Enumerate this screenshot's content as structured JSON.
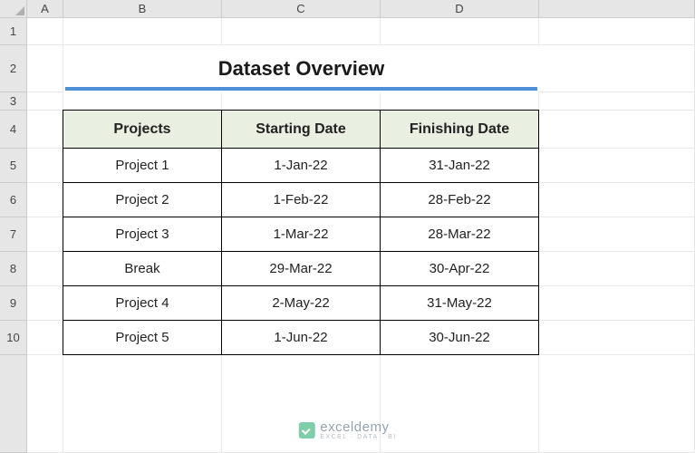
{
  "columns": [
    "A",
    "B",
    "C",
    "D"
  ],
  "rows": [
    "1",
    "2",
    "3",
    "4",
    "5",
    "6",
    "7",
    "8",
    "9",
    "10"
  ],
  "title": "Dataset Overview",
  "chart_data": {
    "type": "table",
    "title": "Dataset Overview",
    "headers": [
      "Projects",
      "Starting Date",
      "Finishing Date"
    ],
    "rows": [
      [
        "Project 1",
        "1-Jan-22",
        "31-Jan-22"
      ],
      [
        "Project 2",
        "1-Feb-22",
        "28-Feb-22"
      ],
      [
        "Project 3",
        "1-Mar-22",
        "28-Mar-22"
      ],
      [
        "Break",
        "29-Mar-22",
        "30-Apr-22"
      ],
      [
        "Project 4",
        "2-May-22",
        "31-May-22"
      ],
      [
        "Project 5",
        "1-Jun-22",
        "30-Jun-22"
      ]
    ]
  },
  "watermark": {
    "main": "exceldemy",
    "sub": "EXCEL · DATA · BI"
  }
}
